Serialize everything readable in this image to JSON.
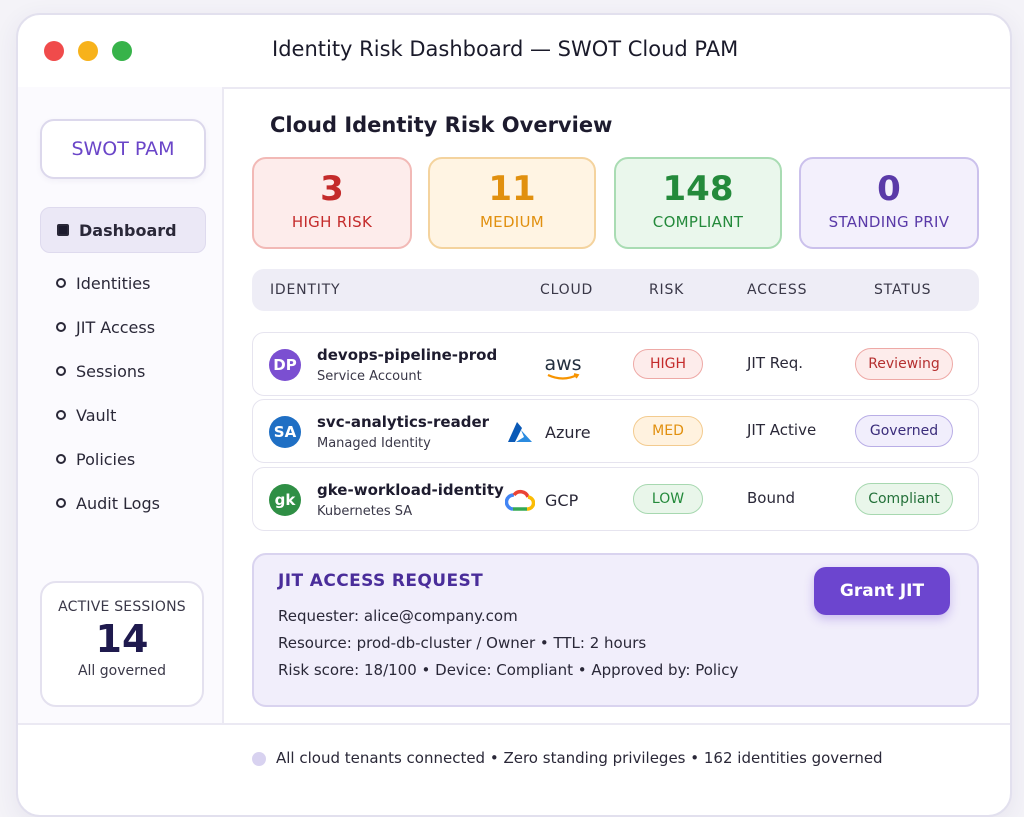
{
  "window": {
    "title": "Identity Risk Dashboard — SWOT Cloud PAM"
  },
  "sidebar": {
    "brand": "SWOT PAM",
    "items": [
      {
        "label": "Dashboard",
        "active": true
      },
      {
        "label": "Identities"
      },
      {
        "label": "JIT Access"
      },
      {
        "label": "Sessions"
      },
      {
        "label": "Vault"
      },
      {
        "label": "Policies"
      },
      {
        "label": "Audit Logs"
      }
    ],
    "sessions": {
      "label": "ACTIVE SESSIONS",
      "value": "14",
      "sub": "All governed"
    }
  },
  "main": {
    "title": "Cloud Identity Risk Overview",
    "stats": [
      {
        "value": "3",
        "label": "HIGH RISK"
      },
      {
        "value": "11",
        "label": "MEDIUM"
      },
      {
        "value": "148",
        "label": "COMPLIANT"
      },
      {
        "value": "0",
        "label": "STANDING PRIV"
      }
    ],
    "table": {
      "headers": [
        "IDENTITY",
        "CLOUD",
        "RISK",
        "ACCESS",
        "STATUS"
      ],
      "rows": [
        {
          "initials": "DP",
          "name": "devops-pipeline-prod",
          "type": "Service Account",
          "cloud": "aws",
          "cloud_icon": "aws-logo",
          "risk": "HIGH",
          "access": "JIT Req.",
          "status": "Reviewing",
          "avatar_color": "#7b4fd1"
        },
        {
          "initials": "SA",
          "name": "svc-analytics-reader",
          "type": "Managed Identity",
          "cloud": "Azure",
          "cloud_icon": "azure-logo",
          "risk": "MED",
          "access": "JIT Active",
          "status": "Governed",
          "avatar_color": "#1f6fc4"
        },
        {
          "initials": "gk",
          "name": "gke-workload-identity",
          "type": "Kubernetes SA",
          "cloud": "GCP",
          "cloud_icon": "gcp-logo",
          "risk": "LOW",
          "access": "Bound",
          "status": "Compliant",
          "avatar_color": "#2f8f45"
        }
      ]
    },
    "jit": {
      "title": "JIT ACCESS REQUEST",
      "requester": "Requester: alice@company.com",
      "resource": "Resource: prod-db-cluster / Owner • TTL: 2 hours",
      "risk": "Risk score: 18/100 • Device: Compliant • Approved by: Policy",
      "button": "Grant JIT"
    }
  },
  "footer": {
    "text": "All cloud tenants connected • Zero standing privileges • 162 identities governed"
  },
  "colors": {
    "accent": "#6c45cf",
    "high": "#c42b2b",
    "medium": "#e1900f",
    "compliant": "#248a3b",
    "standing": "#5a3aa8"
  }
}
